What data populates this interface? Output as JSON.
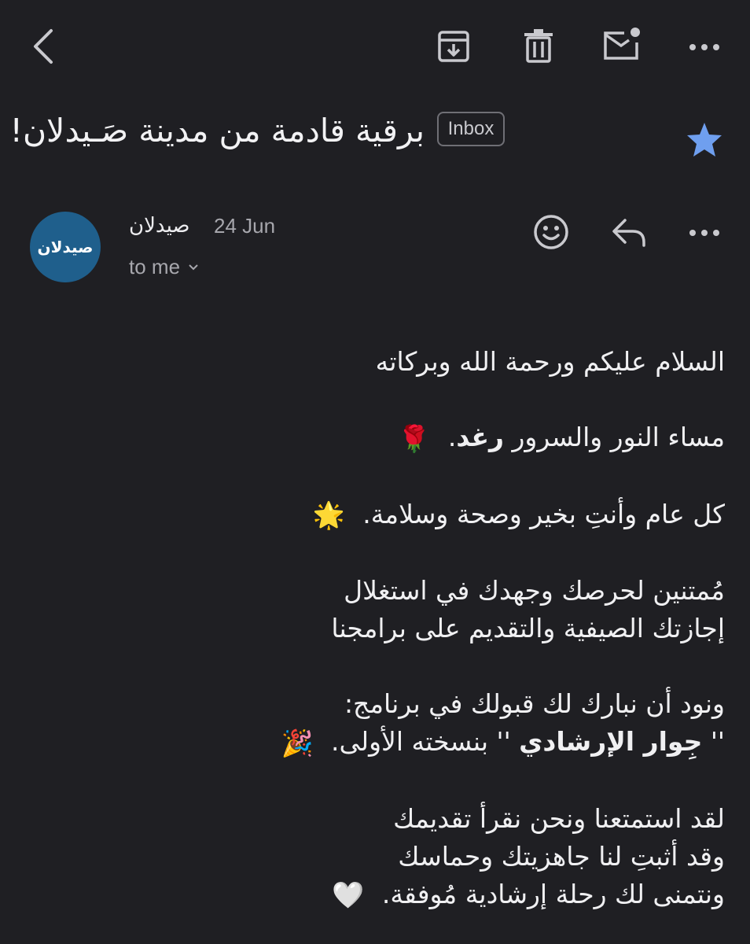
{
  "toolbar": {
    "back_icon": "chevron-left-icon",
    "archive_icon": "archive-icon",
    "delete_icon": "trash-icon",
    "mark_unread_icon": "mail-unread-icon",
    "more_icon": "more-horizontal-icon"
  },
  "email": {
    "subject": "برقية قادمة من مدينة صَـيدلان!",
    "label": "Inbox",
    "starred": true,
    "star_color": "#6f9fef",
    "sender": {
      "name": "صيدلان",
      "avatar_text": "صيدلان",
      "avatar_color": "#1f5f8c",
      "date": "24 Jun",
      "recipient": "to me"
    },
    "actions": {
      "emoji_icon": "smiley-icon",
      "reply_icon": "reply-icon",
      "more_icon": "more-horizontal-icon"
    },
    "body": {
      "p1": "السلام عليكم ورحمة الله وبركاته",
      "p2_a": "مساء النور والسرور ",
      "p2_name": "رغد",
      "p2_b": ".",
      "p2_emoji": "🌹",
      "p3": "كل عام وأنتِ بخير وصحة وسلامة.",
      "p3_emoji": "🌟",
      "p4_l1": "مُمتنين لحرصك وجهدك في استغلال",
      "p4_l2": "إجازتك الصيفية والتقديم على برامجنا",
      "p5_l1": "ونود أن نبارك لك قبولك في برنامج:",
      "p5_l2_a": "'' ",
      "p5_l2_program": "جِوار الإرشادي",
      "p5_l2_b": " '' بنسخته الأولى.",
      "p5_emoji": "🎉",
      "p6_l1": "لقد استمتعنا ونحن نقرأ تقديمك",
      "p6_l2": "وقد أثبتِ لنا جاهزيتك وحماسك",
      "p6_l3": "ونتمنى لك رحلة إرشادية مُوفقة.",
      "p6_emoji": "🤍"
    }
  }
}
